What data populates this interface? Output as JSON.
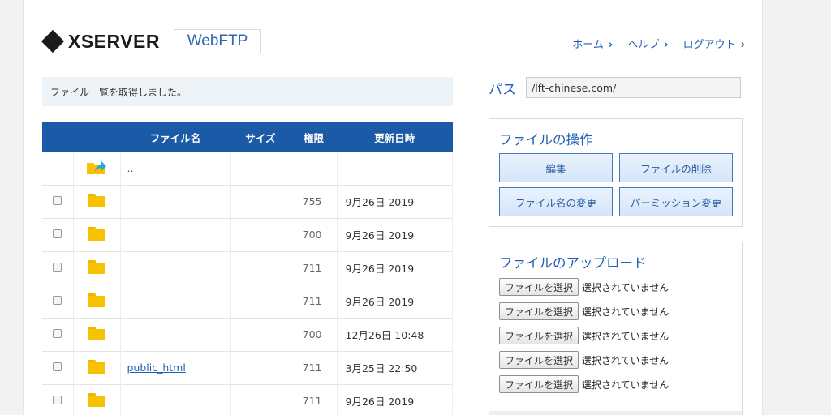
{
  "brand": {
    "logo_text": "XSERVER",
    "product": "WebFTP"
  },
  "nav": [
    {
      "label": "ホーム"
    },
    {
      "label": "ヘルプ"
    },
    {
      "label": "ログアウト"
    }
  ],
  "nav_chevron": "›",
  "message": "ファイル一覧を取得しました。",
  "table": {
    "headers": {
      "name": "ファイル名",
      "size": "サイズ",
      "perm": "権限",
      "date": "更新日時"
    },
    "parent_link": "..",
    "rows": [
      {
        "name": "",
        "perm": "755",
        "date": "9月26日 2019"
      },
      {
        "name": "",
        "perm": "700",
        "date": "9月26日 2019"
      },
      {
        "name": "",
        "perm": "711",
        "date": "9月26日 2019"
      },
      {
        "name": "",
        "perm": "711",
        "date": "9月26日 2019"
      },
      {
        "name": "",
        "perm": "700",
        "date": "12月26日 10:48"
      },
      {
        "name": "public_html",
        "perm": "711",
        "date": "3月25日 22:50"
      },
      {
        "name": "",
        "perm": "711",
        "date": "9月26日 2019"
      }
    ]
  },
  "path": {
    "label": "パス",
    "value": "/lft-chinese.com/"
  },
  "file_ops": {
    "title": "ファイルの操作",
    "buttons": [
      "編集",
      "ファイルの削除",
      "ファイル名の変更",
      "パーミッション変更"
    ]
  },
  "upload": {
    "title": "ファイルのアップロード",
    "choose_label": "ファイルを選択",
    "no_file_label": "選択されていません",
    "slots": 5
  },
  "colors": {
    "accent": "#1b5aa6",
    "link": "#1f5fb5",
    "folder": "#f9c200"
  }
}
